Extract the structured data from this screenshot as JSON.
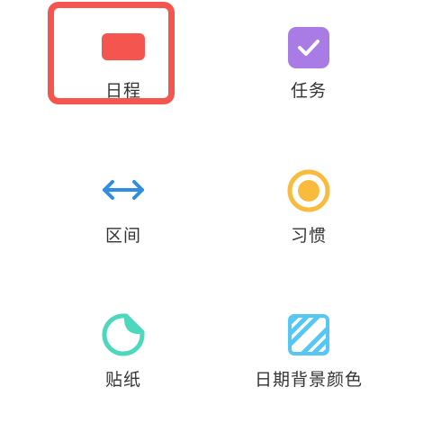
{
  "grid": {
    "items": [
      {
        "label": "日程",
        "icon": "schedule-icon",
        "color": "#f4554e",
        "selected": true
      },
      {
        "label": "任务",
        "icon": "task-checkbox-icon",
        "color": "#a97ce5"
      },
      {
        "label": "区间",
        "icon": "range-arrows-icon",
        "color": "#2f8de4"
      },
      {
        "label": "习惯",
        "icon": "habit-circle-icon",
        "color": "#f9bb3e"
      },
      {
        "label": "贴纸",
        "icon": "sticker-icon",
        "color": "#4dd8bd"
      },
      {
        "label": "日期背景颜色",
        "icon": "date-background-color-icon",
        "color": "#56c7f5"
      }
    ]
  }
}
